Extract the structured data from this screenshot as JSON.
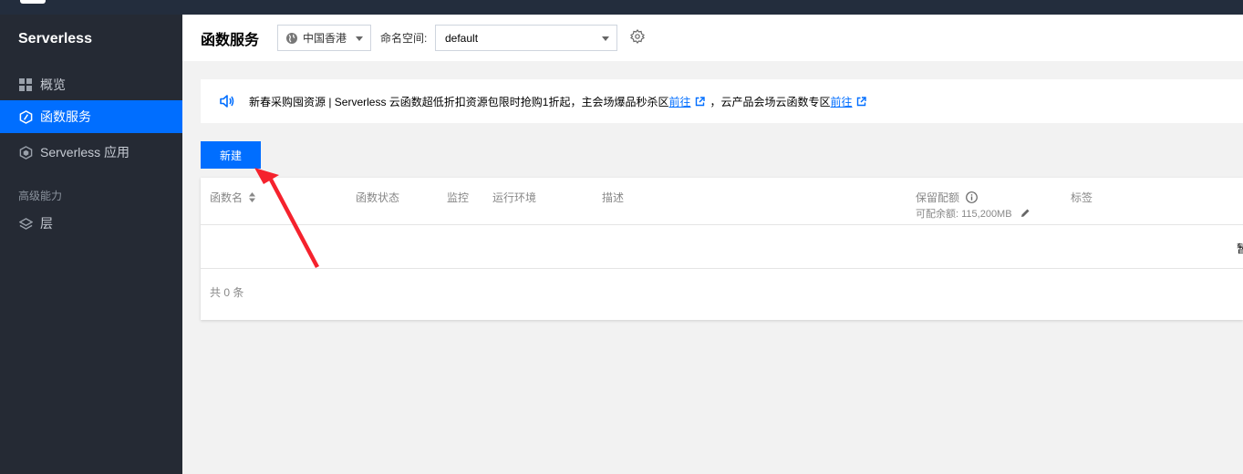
{
  "sidebar": {
    "brand": "Serverless",
    "items": [
      {
        "label": "概览",
        "icon": "grid-icon"
      },
      {
        "label": "函数服务",
        "icon": "function-icon",
        "active": true
      },
      {
        "label": "Serverless 应用",
        "icon": "app-icon"
      }
    ],
    "section_title": "高级能力",
    "advanced_items": [
      {
        "label": "层",
        "icon": "layers-icon"
      }
    ]
  },
  "header": {
    "title": "函数服务",
    "region": "中国香港",
    "namespace_label": "命名空间:",
    "namespace_value": "default"
  },
  "notice": {
    "text_1": "新春采购囤资源 | Serverless 云函数超低折扣资源包限时抢购1折起，主会场爆品秒杀区",
    "link_1": "前往",
    "text_2": "，云产品会场云函数专区",
    "link_2": "前往"
  },
  "toolbar": {
    "new_label": "新建"
  },
  "table": {
    "columns": {
      "name": "函数名",
      "status": "函数状态",
      "monitor": "监控",
      "runtime": "运行环境",
      "description": "描述",
      "reserved": "保留配额",
      "tags": "标签"
    },
    "quota_text": "可配余额: 115,200MB",
    "clipped_cell": "暂",
    "total_text": "共 0 条"
  },
  "colors": {
    "accent": "#006eff",
    "sidebar_bg": "#252a34",
    "topbar_bg": "#232d3d",
    "annotation_arrow": "#f5222d"
  }
}
